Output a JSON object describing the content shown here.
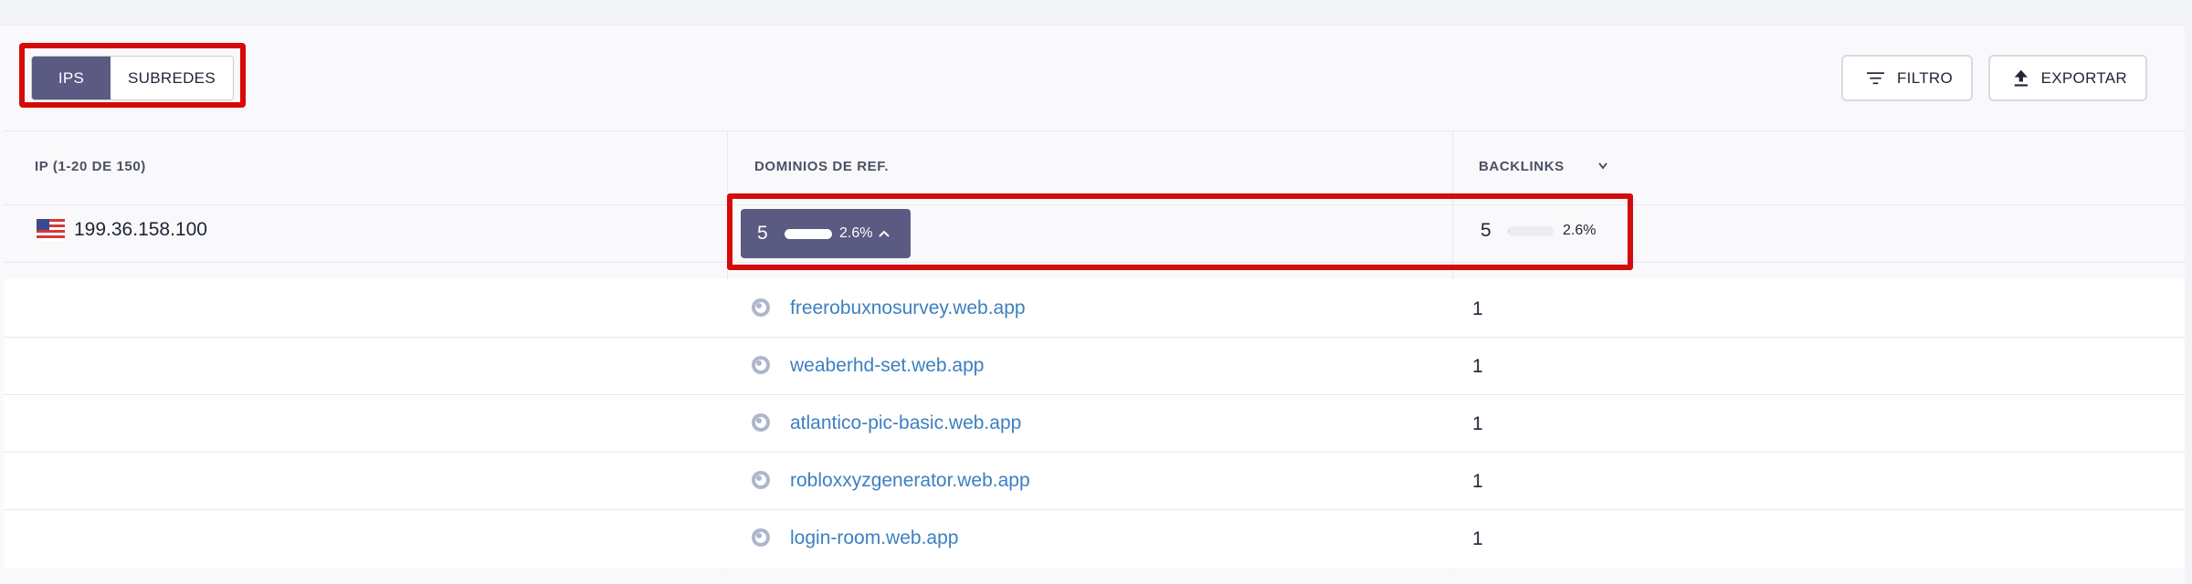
{
  "toggle": {
    "ips_label": "IPS",
    "subnets_label": "SUBREDES",
    "active": "IPS"
  },
  "toolbar": {
    "filter_label": "FILTRO",
    "export_label": "EXPORTAR"
  },
  "table": {
    "headers": {
      "ip": "IP (1-20 DE 150)",
      "ref_domains": "DOMINIOS DE REF.",
      "backlinks": "BACKLINKS"
    },
    "row": {
      "flag": "us-flag-icon",
      "ip": "199.36.158.100",
      "ref_domains": {
        "count": "5",
        "percent": "2.6%"
      },
      "backlinks": {
        "count": "5",
        "percent": "2.6%",
        "bar_fraction": 0.026
      }
    },
    "domains": [
      {
        "name": "freerobuxnosurvey.web.app",
        "backlinks": "1"
      },
      {
        "name": "weaberhd-set.web.app",
        "backlinks": "1"
      },
      {
        "name": "atlantico-pic-basic.web.app",
        "backlinks": "1"
      },
      {
        "name": "robloxxyzgenerator.web.app",
        "backlinks": "1"
      },
      {
        "name": "login-room.web.app",
        "backlinks": "1"
      }
    ]
  },
  "colors": {
    "accent": "#5a5a83",
    "highlight": "#d60a0a",
    "link": "#3d7fc1"
  }
}
